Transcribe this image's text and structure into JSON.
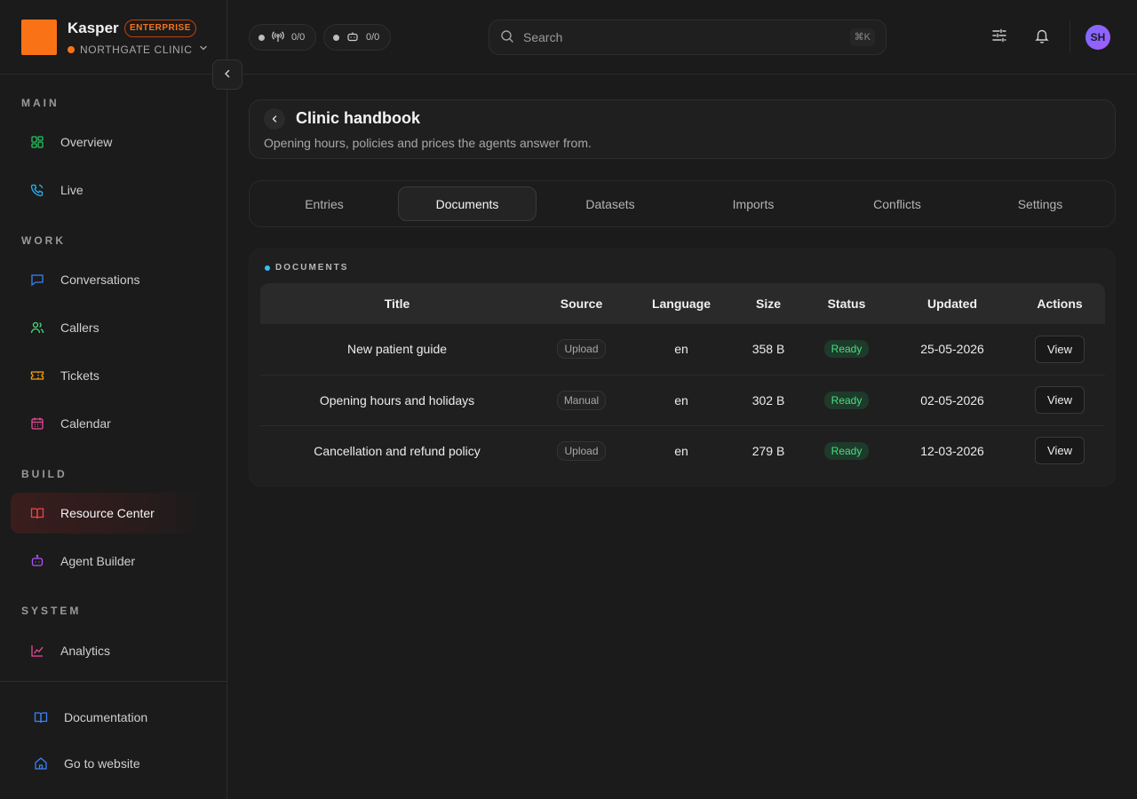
{
  "brand": {
    "name": "Kasper",
    "badge": "ENTERPRISE",
    "org": "NORTHGATE CLINIC",
    "logo_color": "#f97316"
  },
  "header": {
    "pills": [
      {
        "icon": "broadcast-icon",
        "count": "0/0"
      },
      {
        "icon": "bot-icon",
        "count": "0/0"
      }
    ],
    "search": {
      "placeholder": "Search",
      "shortcut": "⌘K"
    },
    "avatar_initials": "SH"
  },
  "sidebar": {
    "sections": {
      "main": "MAIN",
      "work": "WORK",
      "build": "BUILD",
      "system": "SYSTEM"
    },
    "items": {
      "overview": "Overview",
      "live": "Live",
      "conversations": "Conversations",
      "callers": "Callers",
      "tickets": "Tickets",
      "calendar": "Calendar",
      "resource_center": "Resource Center",
      "agent_builder": "Agent Builder",
      "analytics": "Analytics",
      "documentation": "Documentation",
      "go_to_website": "Go to website"
    },
    "active": "Resource Center"
  },
  "page": {
    "title": "Clinic handbook",
    "subtitle": "Opening hours, policies and prices the agents answer from."
  },
  "tabs": [
    "Entries",
    "Documents",
    "Datasets",
    "Imports",
    "Conflicts",
    "Settings"
  ],
  "active_tab": "Documents",
  "documents": {
    "label": "DOCUMENTS",
    "columns": [
      "Title",
      "Source",
      "Language",
      "Size",
      "Status",
      "Updated",
      "Actions"
    ],
    "rows": [
      {
        "title": "New patient guide",
        "source": "Upload",
        "language": "en",
        "size": "358 B",
        "status": "Ready",
        "updated": "25-05-2026",
        "action": "View"
      },
      {
        "title": "Opening hours and holidays",
        "source": "Manual",
        "language": "en",
        "size": "302 B",
        "status": "Ready",
        "updated": "02-05-2026",
        "action": "View"
      },
      {
        "title": "Cancellation and refund policy",
        "source": "Upload",
        "language": "en",
        "size": "279 B",
        "status": "Ready",
        "updated": "12-03-2026",
        "action": "View"
      }
    ]
  }
}
